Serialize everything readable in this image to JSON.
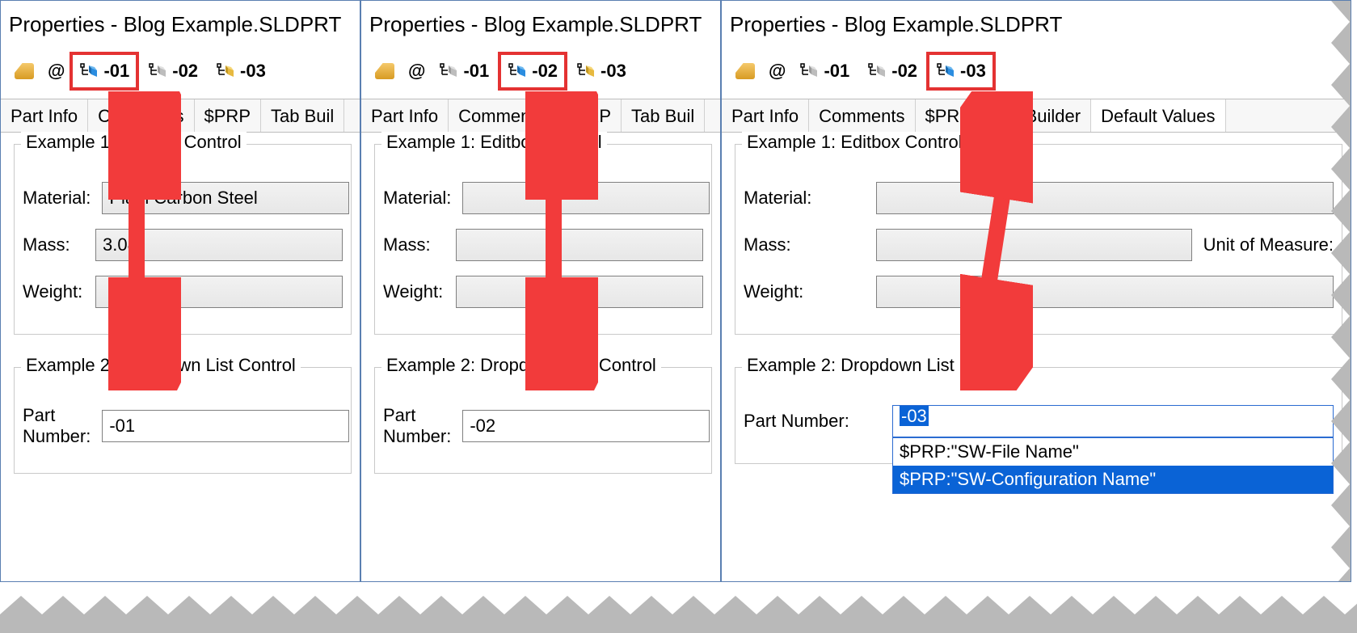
{
  "title": "Properties - Blog Example.SLDPRT",
  "configs": [
    "-01",
    "-02",
    "-03"
  ],
  "at_symbol": "@",
  "tabs_short": [
    "Part Info",
    "Comments",
    "$PRP",
    "Tab Buil"
  ],
  "tabs_long": [
    "Part Info",
    "Comments",
    "$PRP",
    "Tab Builder",
    "Default Values"
  ],
  "group1_legend": "Example 1: Editbox Control",
  "group2_legend": "Example 2: Dropdown List Control",
  "labels": {
    "material": "Material:",
    "mass": "Mass:",
    "weight": "Weight:",
    "unit": "Unit of Measure:",
    "part_number": "Part Number:"
  },
  "panel1": {
    "material": "Plain Carbon Steel",
    "mass": "3.08",
    "weight": "",
    "part_number": "-01",
    "active_config": 0
  },
  "panel2": {
    "material": "",
    "mass": "",
    "weight": "",
    "part_number": "-02",
    "active_config": 1
  },
  "panel3": {
    "material": "",
    "mass": "",
    "weight": "",
    "part_number": "-03",
    "active_config": 2,
    "dropdown_options": [
      "$PRP:\"SW-File Name\"",
      "$PRP:\"SW-Configuration Name\""
    ],
    "dropdown_selected_index": 1
  }
}
